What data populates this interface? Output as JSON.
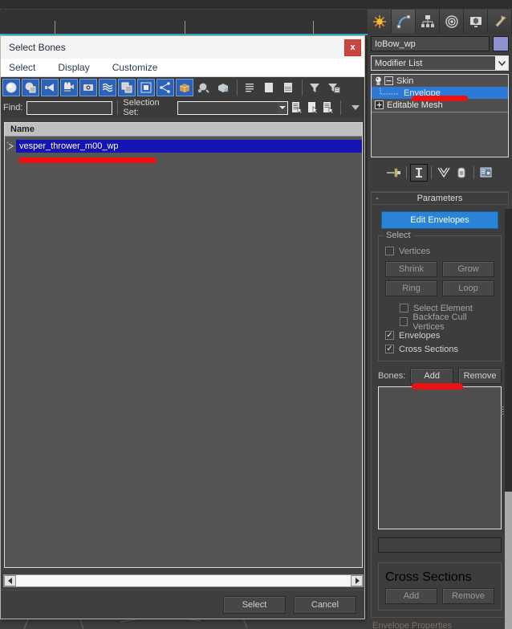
{
  "app": {
    "background_tabs": [
      "",
      "",
      "",
      ""
    ],
    "accent_teal": "#2fb3c9"
  },
  "dialog": {
    "title": "Select Bones",
    "close_label": "x",
    "menu": [
      {
        "label": "Select",
        "name": "menu-select"
      },
      {
        "label": "Display",
        "name": "menu-display"
      },
      {
        "label": "Customize",
        "name": "menu-customize"
      }
    ],
    "toolbar": {
      "toggles": [
        {
          "icon": "display-all-icon",
          "active": true
        },
        {
          "icon": "display-geometry-icon",
          "active": true
        },
        {
          "icon": "display-lights-icon",
          "active": true
        },
        {
          "icon": "display-cameras-icon",
          "active": true
        },
        {
          "icon": "display-helpers-icon",
          "active": true
        },
        {
          "icon": "display-space-warps-icon",
          "active": true
        },
        {
          "icon": "display-groups-icon",
          "active": true
        },
        {
          "icon": "display-xrefs-icon",
          "active": true
        },
        {
          "icon": "display-bones-icon",
          "active": true
        },
        {
          "icon": "display-containers-icon",
          "active": true
        }
      ],
      "extras": [
        {
          "icon": "influenced-objects-icon",
          "active": false
        },
        {
          "icon": "scene-objects-icon",
          "active": false
        }
      ],
      "view_modes": [
        {
          "icon": "list-view-icon",
          "active": false
        },
        {
          "icon": "flat-view-icon",
          "active": false
        },
        {
          "icon": "layer-view-icon",
          "active": false
        }
      ],
      "filters": [
        {
          "icon": "funnel-icon",
          "active": false
        },
        {
          "icon": "funnel-settings-icon",
          "active": false
        }
      ]
    },
    "find": {
      "label": "Find:",
      "value": "",
      "placeholder": ""
    },
    "selection_set": {
      "label": "Selection Set:",
      "value": "",
      "placeholder": "",
      "dropdown_icon": "chevron-down-icon",
      "buttons": [
        {
          "icon": "create-selection-set-icon"
        },
        {
          "icon": "select-objects-icon"
        },
        {
          "icon": "edit-named-selection-sets-icon"
        }
      ],
      "overflow_icon": "overflow-chevron-icon"
    },
    "list": {
      "columns": [
        "Name"
      ],
      "rows": [
        {
          "name": "vesper_thrower_m00_wp",
          "selected": true,
          "expander": "expand-arrow-icon"
        }
      ]
    },
    "hscroll": {
      "left_icon": "scroll-left-arrow-icon",
      "right_icon": "scroll-right-arrow-icon"
    },
    "footer_buttons": [
      {
        "label": "Select",
        "name": "select-button"
      },
      {
        "label": "Cancel",
        "name": "cancel-button"
      }
    ]
  },
  "command_panel": {
    "tabs": [
      {
        "icon": "create-tab-icon",
        "active": false
      },
      {
        "icon": "modify-tab-icon",
        "active": true
      },
      {
        "icon": "hierarchy-tab-icon",
        "active": false
      },
      {
        "icon": "motion-tab-icon",
        "active": false
      },
      {
        "icon": "display-tab-icon",
        "active": false
      },
      {
        "icon": "utilities-tab-icon",
        "active": false
      }
    ],
    "object_name": "IoBow_wp",
    "object_color": "#8d91cf",
    "modifier_list_label": "Modifier List",
    "modifier_stack": [
      {
        "label": "Skin",
        "icon": "lightbulb-icon",
        "box": "minus",
        "selected": false,
        "indent": 0
      },
      {
        "label": "Envelope",
        "icon": "",
        "box": "",
        "selected": true,
        "indent": 1
      },
      {
        "label": "Editable Mesh",
        "icon": "",
        "box": "plus",
        "selected": false,
        "indent": 0
      }
    ],
    "stack_tools": [
      {
        "icon": "pin-stack-icon"
      },
      {
        "icon": "show-end-result-icon",
        "framed": true
      },
      {
        "icon": "make-unique-icon"
      },
      {
        "icon": "remove-modifier-icon"
      },
      {
        "icon": "configure-modifier-sets-icon"
      }
    ],
    "rollout": {
      "collapse_glyph": "-",
      "title": "Parameters",
      "edit_envelopes_label": "Edit Envelopes",
      "edit_envelopes_color": "#2a84d8",
      "select_group": {
        "title": "Select",
        "vertices": {
          "label": "Vertices",
          "checked": false,
          "enabled": false
        },
        "buttons": [
          {
            "label": "Shrink",
            "name": "shrink-button"
          },
          {
            "label": "Grow",
            "name": "grow-button"
          },
          {
            "label": "Ring",
            "name": "ring-button"
          },
          {
            "label": "Loop",
            "name": "loop-button"
          }
        ],
        "select_element": {
          "label": "Select Element",
          "checked": false
        },
        "backface_cull": {
          "label": "Backface Cull Vertices",
          "checked": false
        },
        "envelopes": {
          "label": "Envelopes",
          "checked": true
        },
        "cross_sections": {
          "label": "Cross Sections",
          "checked": true
        }
      },
      "bones": {
        "label": "Bones:",
        "add_label": "Add",
        "remove_label": "Remove",
        "list_items": []
      },
      "cross_sections_group": {
        "title": "Cross Sections",
        "add_label": "Add",
        "remove_label": "Remove"
      },
      "partial_bottom_label": "Envelope Properties"
    }
  },
  "annotations": {
    "color": "#ee1111",
    "marks": [
      "under-list-row",
      "under-envelope-stack-entry",
      "under-bones-add-button"
    ]
  }
}
